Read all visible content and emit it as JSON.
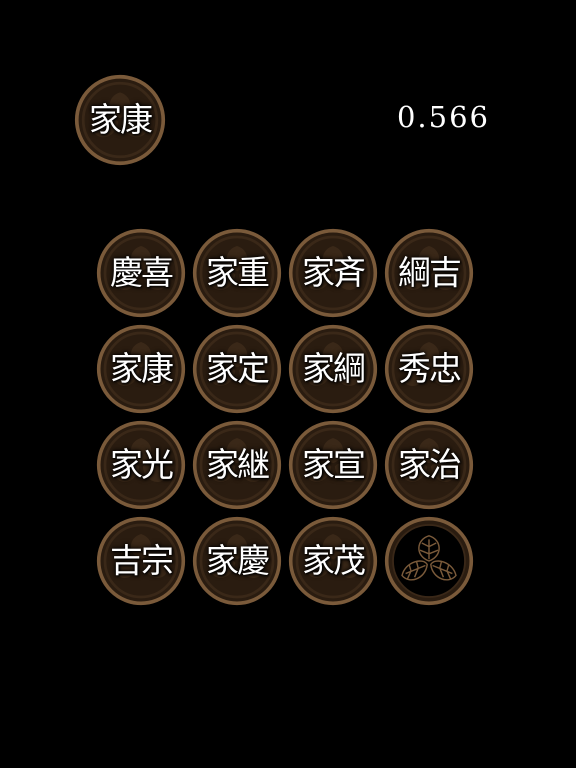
{
  "game": {
    "target": "家康",
    "timer": "0.566"
  },
  "colors": {
    "background": "#000000",
    "crest_fill": "#2a1c10",
    "crest_ring": "#7a5a3a",
    "crest_emblem": "#3a2818",
    "text": "#ffffff"
  },
  "board": {
    "tiles": [
      {
        "label": "慶喜"
      },
      {
        "label": "家重"
      },
      {
        "label": "家斉"
      },
      {
        "label": "綱吉"
      },
      {
        "label": "家康"
      },
      {
        "label": "家定"
      },
      {
        "label": "家綱"
      },
      {
        "label": "秀忠"
      },
      {
        "label": "家光"
      },
      {
        "label": "家継"
      },
      {
        "label": "家宣"
      },
      {
        "label": "家治"
      },
      {
        "label": "吉宗"
      },
      {
        "label": "家慶"
      },
      {
        "label": "家茂"
      },
      {
        "label": ""
      }
    ]
  }
}
